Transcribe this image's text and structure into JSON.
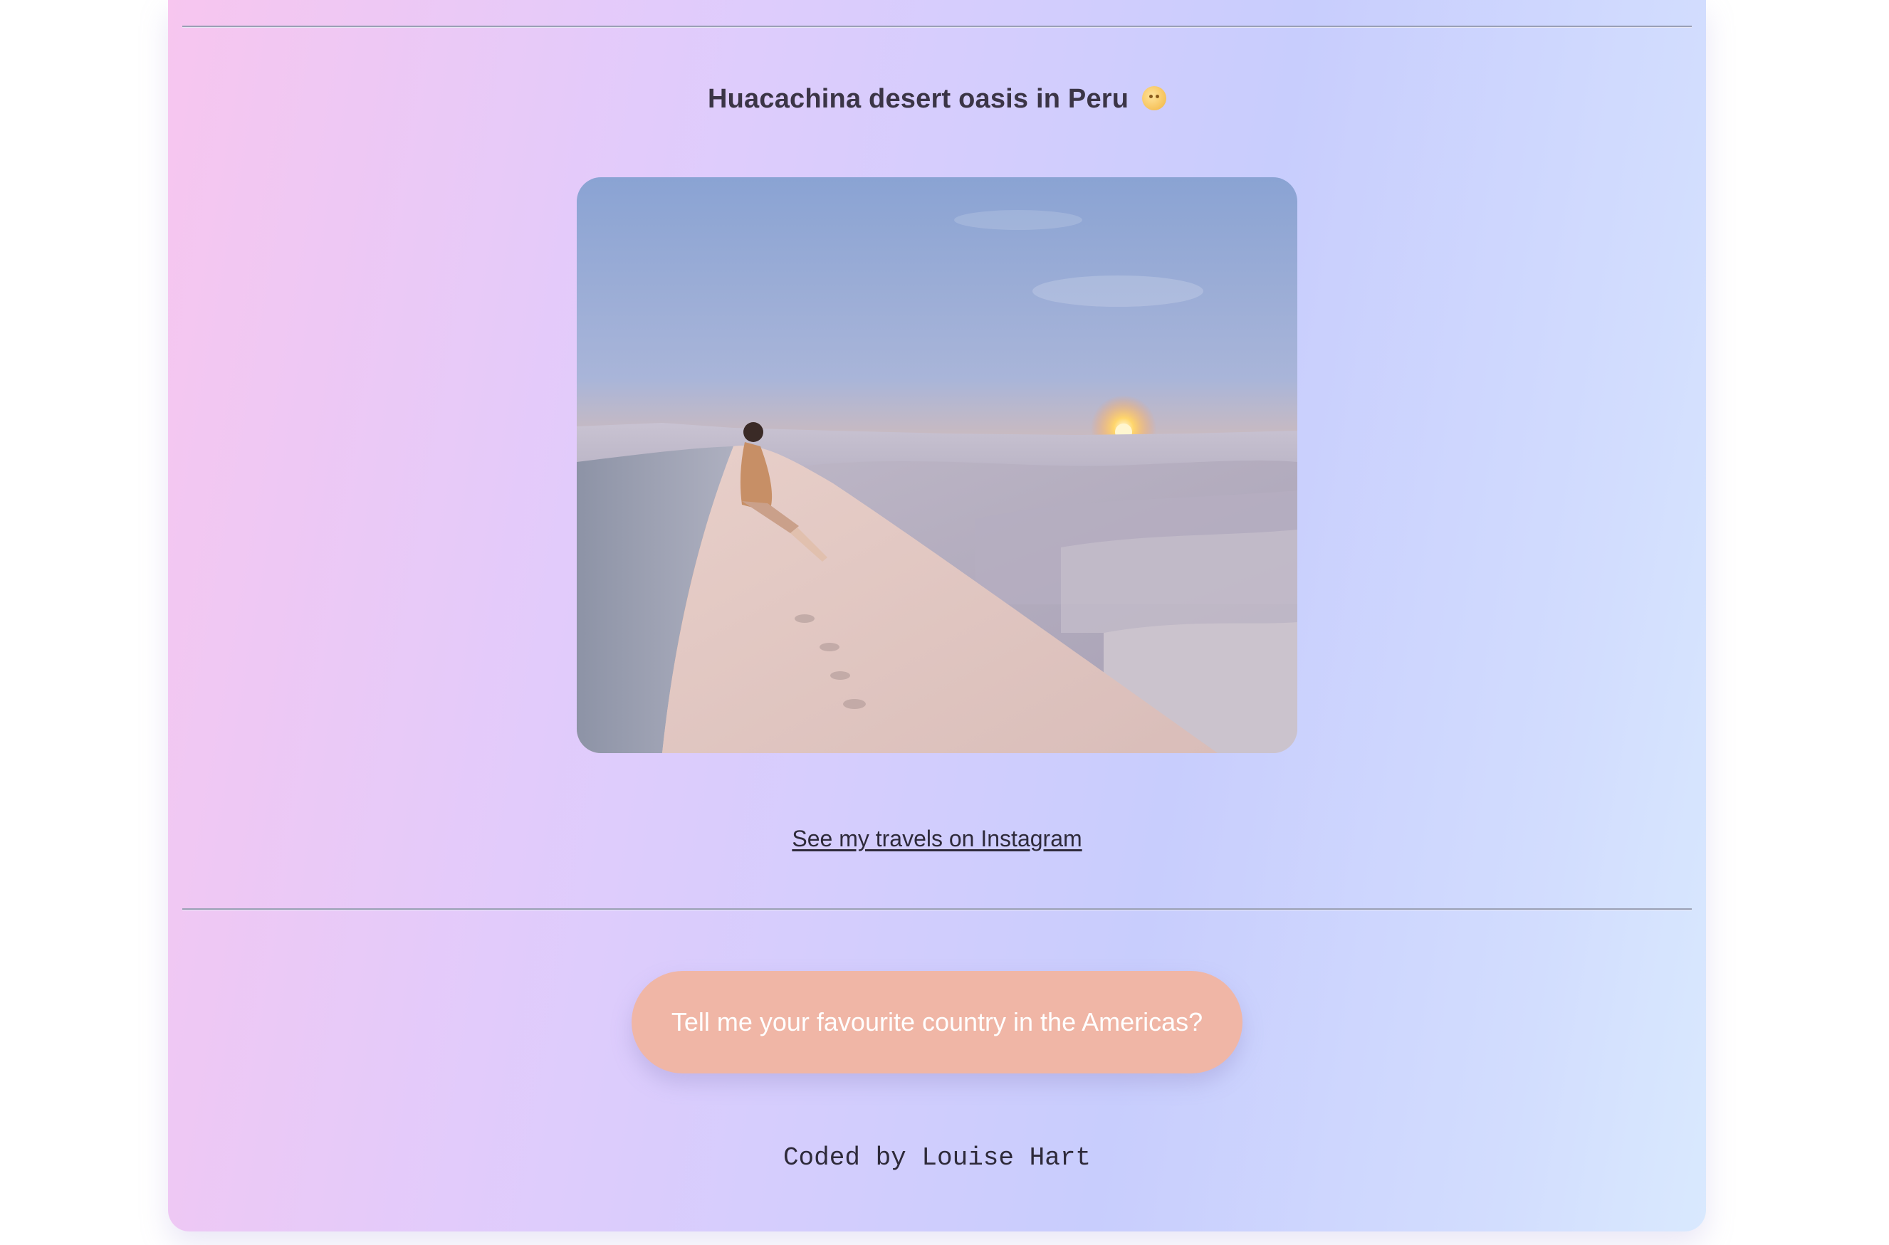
{
  "section": {
    "title": "Huacachina desert oasis in Peru",
    "title_emoji_icon": "smiling-face-emoji-icon",
    "photo_description_icon": "desert-sunset-photo",
    "instagram_link_text": "See my travels on Instagram"
  },
  "cta": {
    "label": "Tell me your favourite country in the Americas?"
  },
  "footer": {
    "credit": "Coded by Louise Hart"
  },
  "colors": {
    "button_bg": "#f0b6a6",
    "text": "#3b3546",
    "gradient_left": "#f7c6ef",
    "gradient_mid": "#c8cdfd",
    "gradient_right": "#d9e9fe"
  }
}
